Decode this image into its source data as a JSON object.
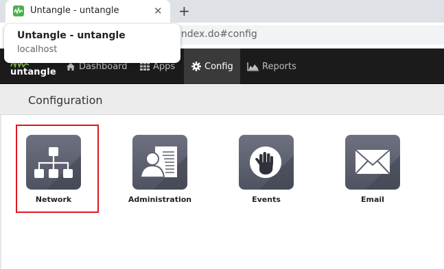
{
  "browser": {
    "tab_title": "Untangle - untangle",
    "tab_close": "✕",
    "new_tab": "+",
    "url_visible": "index.do#config",
    "tooltip": {
      "title": "Untangle - untangle",
      "host": "localhost"
    }
  },
  "app": {
    "logo_text": "untangle",
    "nav": [
      {
        "label": "Dashboard",
        "icon": "home-icon",
        "active": false
      },
      {
        "label": "Apps",
        "icon": "grid-icon",
        "active": false
      },
      {
        "label": "Config",
        "icon": "gear-icon",
        "active": true
      },
      {
        "label": "Reports",
        "icon": "area-chart-icon",
        "active": false
      }
    ]
  },
  "page": {
    "title": "Configuration",
    "tiles": [
      {
        "label": "Network",
        "icon": "network-icon",
        "selected": true
      },
      {
        "label": "Administration",
        "icon": "administration-icon",
        "selected": false
      },
      {
        "label": "Events",
        "icon": "hand-icon",
        "selected": false
      },
      {
        "label": "Email",
        "icon": "envelope-icon",
        "selected": false
      }
    ]
  },
  "colors": {
    "nav_bg": "#1b1b1b",
    "nav_active_bg": "#3a3a3a",
    "tile_bg": "#5d6170",
    "highlight": "#e0141e",
    "favicon": "#4caf50"
  }
}
